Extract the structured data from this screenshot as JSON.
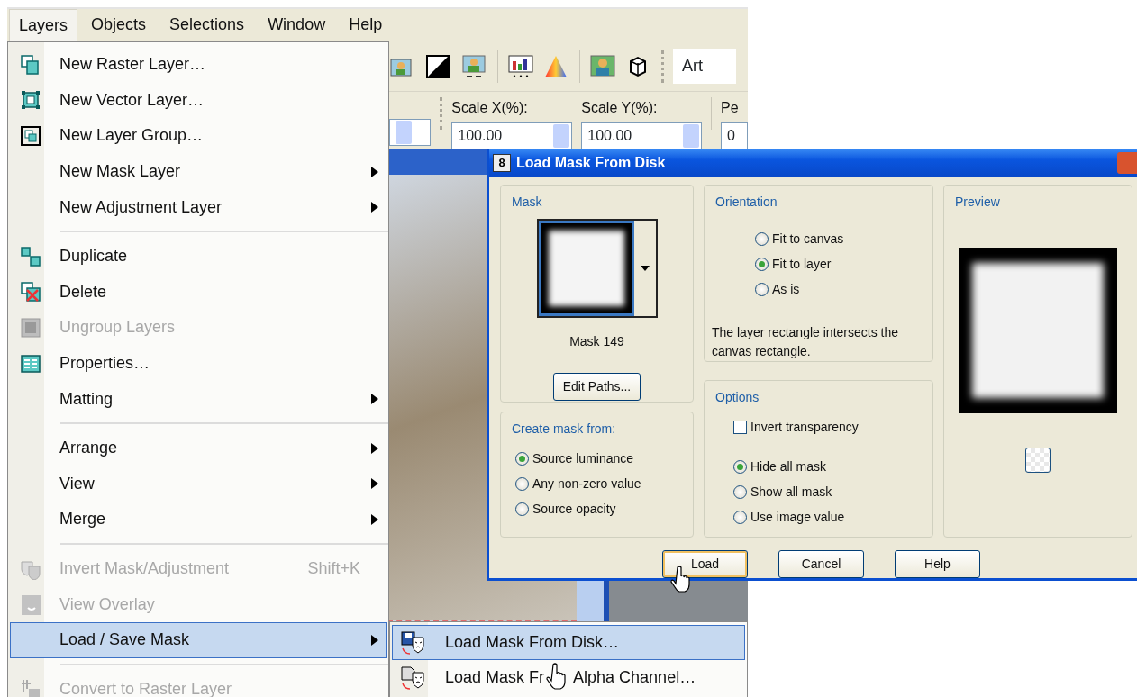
{
  "app": {
    "menubar": [
      {
        "label": "Layers",
        "selected": true
      },
      {
        "label": "Objects",
        "selected": false
      },
      {
        "label": "Selections",
        "selected": false
      },
      {
        "label": "Window",
        "selected": false
      },
      {
        "label": "Help",
        "selected": false
      }
    ],
    "toolbar": {
      "preset_value": "Art"
    },
    "tool_options": {
      "spin_fields": [
        {
          "label": "Scale X(%):",
          "value": "100.00"
        },
        {
          "label": "Scale Y(%):",
          "value": "100.00"
        },
        {
          "label": "Pe",
          "value": "0"
        }
      ]
    }
  },
  "layers_menu": {
    "items": [
      {
        "kind": "item",
        "label": "New Raster Layer…",
        "disabled": false,
        "submenu": false,
        "selected": false
      },
      {
        "kind": "item",
        "label": "New Vector Layer…",
        "disabled": false,
        "submenu": false,
        "selected": false
      },
      {
        "kind": "item",
        "label": "New Layer Group…",
        "disabled": false,
        "submenu": false,
        "selected": false
      },
      {
        "kind": "item",
        "label": "New Mask Layer",
        "disabled": false,
        "submenu": true,
        "selected": false
      },
      {
        "kind": "item",
        "label": "New Adjustment Layer",
        "disabled": false,
        "submenu": true,
        "selected": false
      },
      {
        "kind": "separator"
      },
      {
        "kind": "item",
        "label": "Duplicate",
        "disabled": false,
        "submenu": false,
        "selected": false
      },
      {
        "kind": "item",
        "label": "Delete",
        "disabled": false,
        "submenu": false,
        "selected": false
      },
      {
        "kind": "item",
        "label": "Ungroup Layers",
        "disabled": true,
        "submenu": false,
        "selected": false
      },
      {
        "kind": "item",
        "label": "Properties…",
        "disabled": false,
        "submenu": false,
        "selected": false
      },
      {
        "kind": "item",
        "label": "Matting",
        "disabled": false,
        "submenu": true,
        "selected": false
      },
      {
        "kind": "separator"
      },
      {
        "kind": "item",
        "label": "Arrange",
        "disabled": false,
        "submenu": true,
        "selected": false
      },
      {
        "kind": "item",
        "label": "View",
        "disabled": false,
        "submenu": true,
        "selected": false
      },
      {
        "kind": "item",
        "label": "Merge",
        "disabled": false,
        "submenu": true,
        "selected": false
      },
      {
        "kind": "separator"
      },
      {
        "kind": "item",
        "label": "Invert Mask/Adjustment",
        "shortcut": "Shift+K",
        "disabled": true,
        "submenu": false,
        "selected": false
      },
      {
        "kind": "item",
        "label": "View Overlay",
        "disabled": true,
        "submenu": false,
        "selected": false
      },
      {
        "kind": "item",
        "label": "Load / Save Mask",
        "disabled": false,
        "submenu": true,
        "selected": true
      },
      {
        "kind": "separator"
      },
      {
        "kind": "item",
        "label": "Convert to Raster Layer",
        "disabled": true,
        "submenu": false,
        "selected": false
      }
    ]
  },
  "submenu": {
    "items": [
      {
        "label": "Load Mask From Disk…",
        "selected": true
      },
      {
        "label": "Load Mask Fr",
        "label_after_cursor": "Alpha Channel…",
        "selected": false
      }
    ]
  },
  "dialog": {
    "title_icon": "8",
    "title": "Load Mask From Disk",
    "mask_group": {
      "title": "Mask",
      "mask_name": "Mask 149",
      "edit_button": "Edit Paths..."
    },
    "create_group": {
      "title": "Create mask from:",
      "options": [
        {
          "label": "Source luminance",
          "selected": true
        },
        {
          "label": "Any non-zero value",
          "selected": false
        },
        {
          "label": "Source opacity",
          "selected": false
        }
      ]
    },
    "orientation_group": {
      "title": "Orientation",
      "options": [
        {
          "label": "Fit to canvas",
          "selected": false
        },
        {
          "label": "Fit to layer",
          "selected": true
        },
        {
          "label": "As is",
          "selected": false
        }
      ],
      "description": "The layer rectangle intersects the canvas rectangle."
    },
    "options_group": {
      "title": "Options",
      "invert": {
        "label": "Invert transparency",
        "checked": false
      },
      "options": [
        {
          "label": "Hide all mask",
          "selected": true
        },
        {
          "label": "Show all mask",
          "selected": false
        },
        {
          "label": "Use image value",
          "selected": false
        }
      ]
    },
    "preview_group": {
      "title": "Preview"
    },
    "buttons": [
      {
        "label": "Load",
        "default": true
      },
      {
        "label": "Cancel",
        "default": false
      },
      {
        "label": "Help",
        "default": false
      }
    ]
  }
}
